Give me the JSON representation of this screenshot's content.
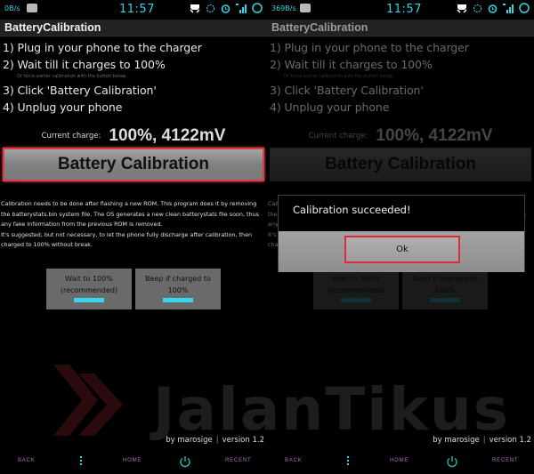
{
  "colors": {
    "accent_cyan": "#33d5e5",
    "highlight_red": "#e03a45",
    "nav_text": "#b06ec0",
    "toggle_bar": "#37d7f3"
  },
  "left": {
    "statusbar": {
      "speed": "0B/s",
      "time": "11:57",
      "icons": [
        "bbm-icon",
        "headset-icon",
        "sync-icon",
        "alarm-icon",
        "signal-icon",
        "battery-ring-icon"
      ]
    },
    "app_title": "BatteryCalibration",
    "steps": [
      "1) Plug in your phone to the charger",
      "2) Wait till it charges to 100%",
      "3) Click 'Battery Calibration'",
      "4) Unplug your phone"
    ],
    "hint": "Or force earlier calibration with the button below.",
    "charge_label": "Current charge:",
    "charge_value": "100%, 4122mV",
    "calibration_button": "Battery Calibration",
    "description": [
      "Calibration needs to be done after flashing a new ROM. This program does it by removing the batterystats.bin system file. The OS generates a new clean batterystats file soon, thus any fake information from the previous ROM is removed.",
      "It's suggested, but not necessary, to let the phone fully discharge after calibration, then charged to 100% without break."
    ],
    "toggles": [
      {
        "label_line1": "Wait to 100%",
        "label_line2": "(recommended)",
        "enabled": true
      },
      {
        "label_line1": "Beep if charged to",
        "label_line2": "100%",
        "enabled": true
      }
    ],
    "credit_author": "by marosige",
    "credit_version": "version 1.2",
    "nav": {
      "back": "BACK",
      "home": "HOME",
      "recent": "RECENT"
    }
  },
  "right": {
    "statusbar": {
      "speed": "369B/s",
      "time": "11:57"
    },
    "app_title": "BatteryCalibration",
    "steps": [
      "1) Plug in your phone to the charger",
      "2) Wait till it charges to 100%",
      "3) Click 'Battery Calibration'",
      "4) Unplug your phone"
    ],
    "hint": "Or force earlier calibration with the button below.",
    "charge_label": "Current charge:",
    "charge_value": "100%, 4122mV",
    "calibration_button": "Battery Calibration",
    "description": [
      "Calibration needs to be done after flashing a new ROM. This program does it by removing the batterystats.bin system file. The OS generates a new clean batterystats file soon, thus any fake information from the previous ROM is removed.",
      "It's suggested, but not necessary, to let the phone fully discharge after calibration, then charged to 100% without break."
    ],
    "toggles": [
      {
        "label_line1": "Wait to 100%",
        "label_line2": "(recommended)"
      },
      {
        "label_line1": "Beep if charged to",
        "label_line2": "100%"
      }
    ],
    "dialog": {
      "message": "Calibration succeeded!",
      "ok_label": "Ok"
    },
    "credit_author": "by marosige",
    "credit_version": "version 1.2",
    "nav": {
      "back": "BACK",
      "home": "HOME",
      "recent": "RECENT"
    }
  },
  "watermark": {
    "text": "JalanTikus"
  }
}
